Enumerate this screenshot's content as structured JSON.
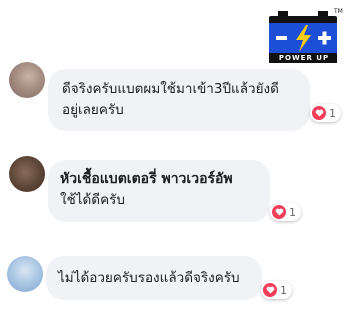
{
  "brand": {
    "logo_text": "POWER UP",
    "trademark": "TM"
  },
  "comments": [
    {
      "text_line1": "ดีจริงครับแบตผมใช้มาเข้า3ปีแล้วยังดี",
      "text_line2": "อยู่เลยครับ",
      "reaction_count": "1"
    },
    {
      "author": "หัวเชื้อแบตเตอรี่ พาวเวอร์อัพ",
      "text": "ใช้ได้ดีครับ",
      "reaction_count": "1"
    },
    {
      "text": "ไม่ได้อวยครับรองแล้วดีจริงครับ",
      "reaction_count": "1"
    }
  ],
  "colors": {
    "bubble": "#f0f2f5",
    "heart": "#f33e58",
    "logo_blue": "#1d4ed8",
    "logo_yellow": "#facc15"
  }
}
